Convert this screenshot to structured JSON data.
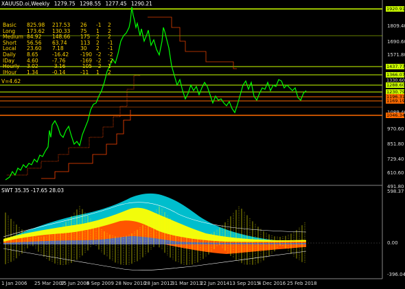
{
  "header": {
    "symbol": "XAUUSD.oi,Weekly",
    "ohlc": [
      "1279.75",
      "1298.55",
      "1277.45",
      "1290.21"
    ]
  },
  "stats": [
    [
      "Basic",
      "825.98",
      "217.53",
      "26",
      "-1",
      "2"
    ],
    [
      "Long",
      "173.62",
      "130.33",
      "75",
      "1",
      "2"
    ],
    [
      "Medium",
      "84.92",
      "148.66",
      "175",
      "2",
      "2"
    ],
    [
      "Short",
      "56.56",
      "63.74",
      "113",
      "2",
      "-1"
    ],
    [
      "Local",
      "23.60",
      "7.18",
      "30",
      "2",
      "-1"
    ],
    [
      "Daily",
      "8.65",
      "-16.42",
      "-190",
      "-2",
      "-2"
    ],
    [
      "IDay",
      "4.60",
      "-7.76",
      "-169",
      "-2",
      "-2"
    ],
    [
      "Hourly",
      "3.02",
      "-3.16",
      "-105",
      "-2",
      "1"
    ],
    [
      "IHour",
      "1.34",
      "-0.14",
      "-11",
      "1",
      "2"
    ]
  ],
  "v_label": "V=4.62",
  "price_axis": [
    "1809.40",
    "1690.60",
    "1571.80",
    "1089.40",
    "970.60",
    "851.80",
    "729.40",
    "610.60",
    "491.80"
  ],
  "price_tags": [
    {
      "value": "1920.91",
      "color": "#ccff00",
      "text": "#000"
    },
    {
      "value": "1437.77",
      "color": "#ccff00",
      "text": "#000"
    },
    {
      "value": "1366.07",
      "color": "#ccff00",
      "text": "#000"
    },
    {
      "value": "1330.60",
      "color": "#000",
      "text": "#ddd"
    },
    {
      "value": "1288.60",
      "color": "#ccff00",
      "text": "#000"
    },
    {
      "value": "1230.79",
      "color": "#ccff00",
      "text": "#000"
    },
    {
      "value": "1196.31",
      "color": "#ff6a00",
      "text": "#000"
    },
    {
      "value": "1169.19",
      "color": "#ff6a00",
      "text": "#000"
    },
    {
      "value": "1046.34",
      "color": "#ff6a00",
      "text": "#000"
    }
  ],
  "subwindow": {
    "title": "SWT 35.35 -17.65 28.03",
    "axis": [
      "598.37",
      "0.00",
      "-396.04"
    ]
  },
  "dates": [
    "1 Jan 2006",
    "25 Mar 2007",
    "15 Jun 2008",
    "6 Sep 2009",
    "28 Nov 2010",
    "28 Jan 2012",
    "31 Mar 2013",
    "22 Jun 2014",
    "13 Sep 2015",
    "4 Dec 2016",
    "25 Feb 2018"
  ],
  "colors": {
    "price_line": "#00ff00",
    "support": "#ff6a00",
    "resistance": "#ccff00",
    "wave_cyan": "#00c8d8",
    "wave_yellow": "#ffff00",
    "wave_orange": "#ff5500",
    "wave_blue": "#3a6ad8"
  }
}
